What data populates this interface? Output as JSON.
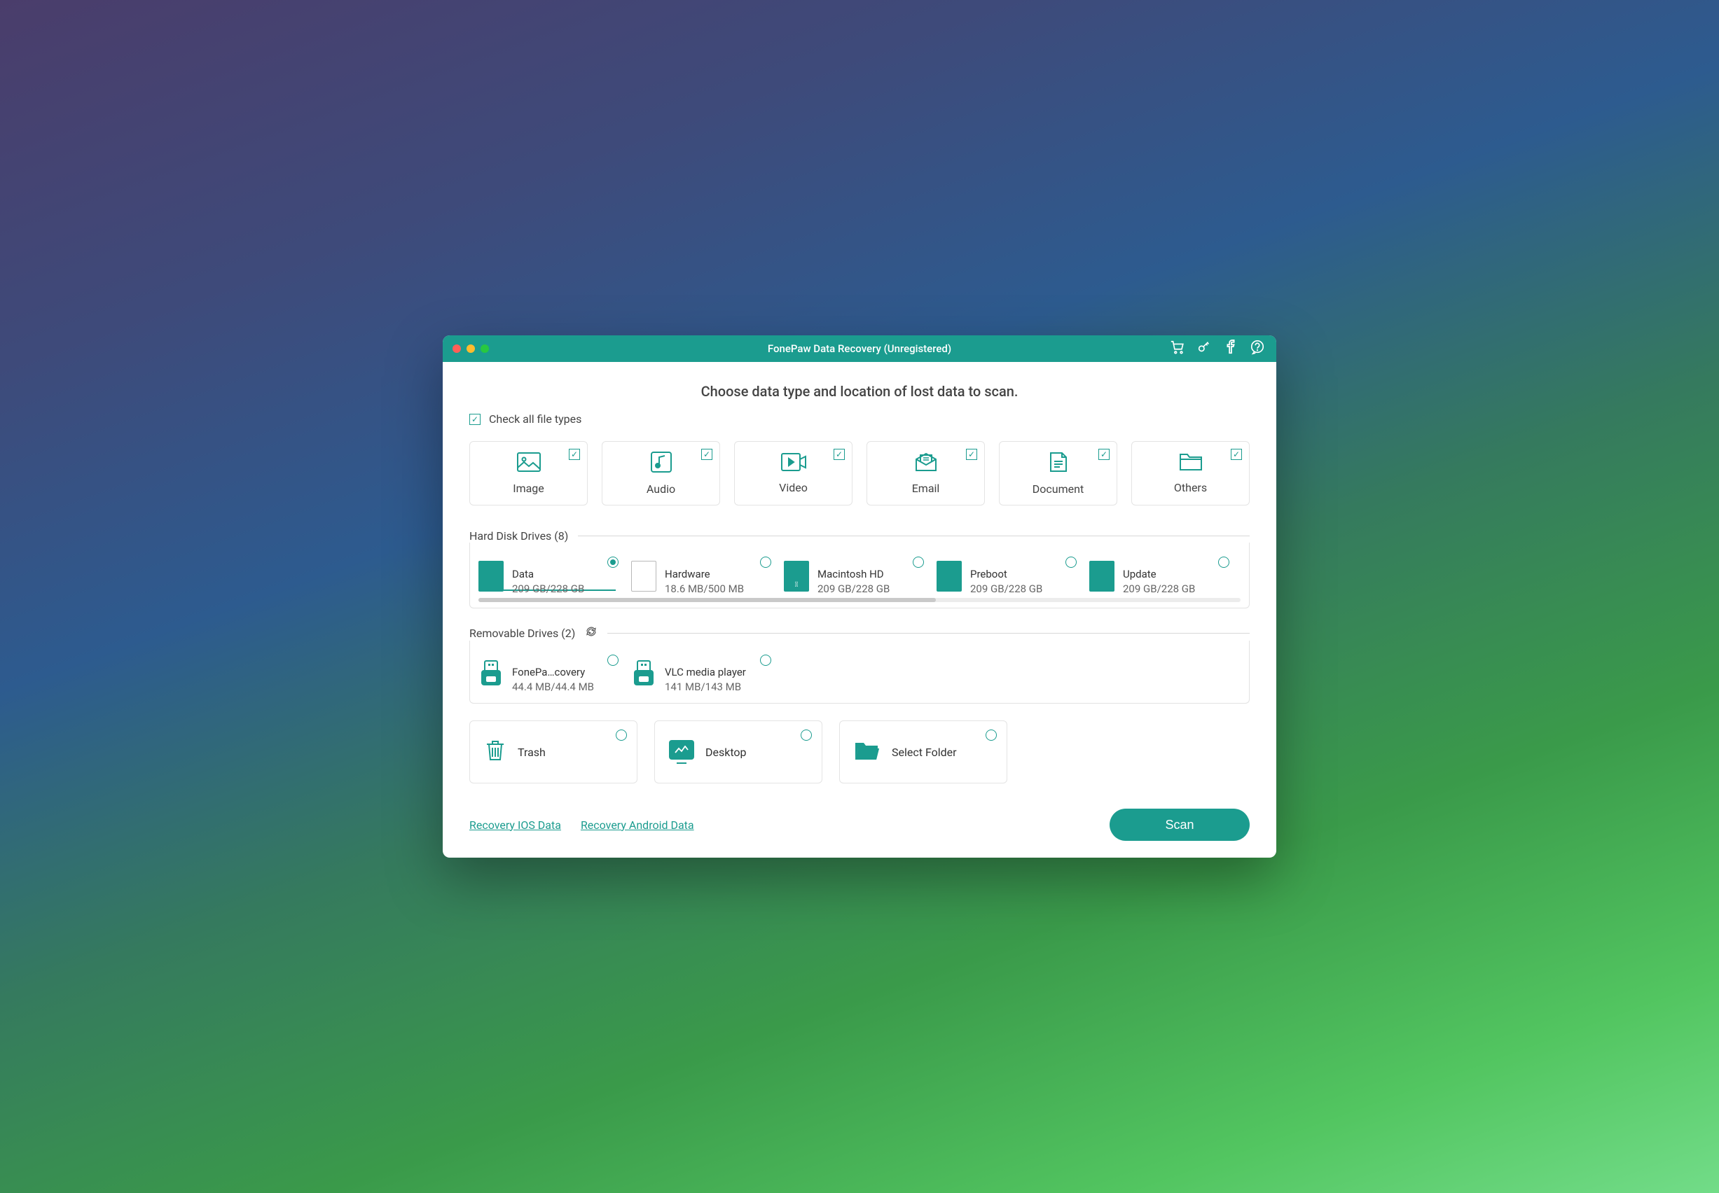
{
  "colors": {
    "accent": "#1b9c8f",
    "traffic_close": "#ff5f57",
    "traffic_min": "#febc2e",
    "traffic_max": "#28c840"
  },
  "titlebar": {
    "title": "FonePaw Data Recovery (Unregistered)"
  },
  "heading": "Choose data type and location of lost data to scan.",
  "check_all": {
    "label": "Check all file types",
    "checked": true
  },
  "types": [
    {
      "key": "image",
      "label": "Image",
      "checked": true
    },
    {
      "key": "audio",
      "label": "Audio",
      "checked": true
    },
    {
      "key": "video",
      "label": "Video",
      "checked": true
    },
    {
      "key": "email",
      "label": "Email",
      "checked": true
    },
    {
      "key": "document",
      "label": "Document",
      "checked": true
    },
    {
      "key": "others",
      "label": "Others",
      "checked": true
    }
  ],
  "hdd": {
    "title": "Hard Disk Drives (8)",
    "drives": [
      {
        "name": "Data",
        "size": "209 GB/228 GB",
        "selected": true,
        "style": "teal"
      },
      {
        "name": "Hardware",
        "size": "18.6 MB/500 MB",
        "selected": false,
        "style": "outline"
      },
      {
        "name": "Macintosh HD",
        "size": "209 GB/228 GB",
        "selected": false,
        "style": "apple"
      },
      {
        "name": "Preboot",
        "size": "209 GB/228 GB",
        "selected": false,
        "style": "teal"
      },
      {
        "name": "Update",
        "size": "209 GB/228 GB",
        "selected": false,
        "style": "teal"
      }
    ]
  },
  "removable": {
    "title": "Removable Drives (2)",
    "drives": [
      {
        "name": "FonePa…covery",
        "size": "44.4 MB/44.4 MB",
        "selected": false
      },
      {
        "name": "VLC media player",
        "size": "141 MB/143 MB",
        "selected": false
      }
    ]
  },
  "locations": [
    {
      "key": "trash",
      "label": "Trash"
    },
    {
      "key": "desktop",
      "label": "Desktop"
    },
    {
      "key": "select",
      "label": "Select Folder"
    }
  ],
  "footer": {
    "ios_link": "Recovery IOS Data",
    "android_link": "Recovery Android Data",
    "scan_label": "Scan"
  }
}
